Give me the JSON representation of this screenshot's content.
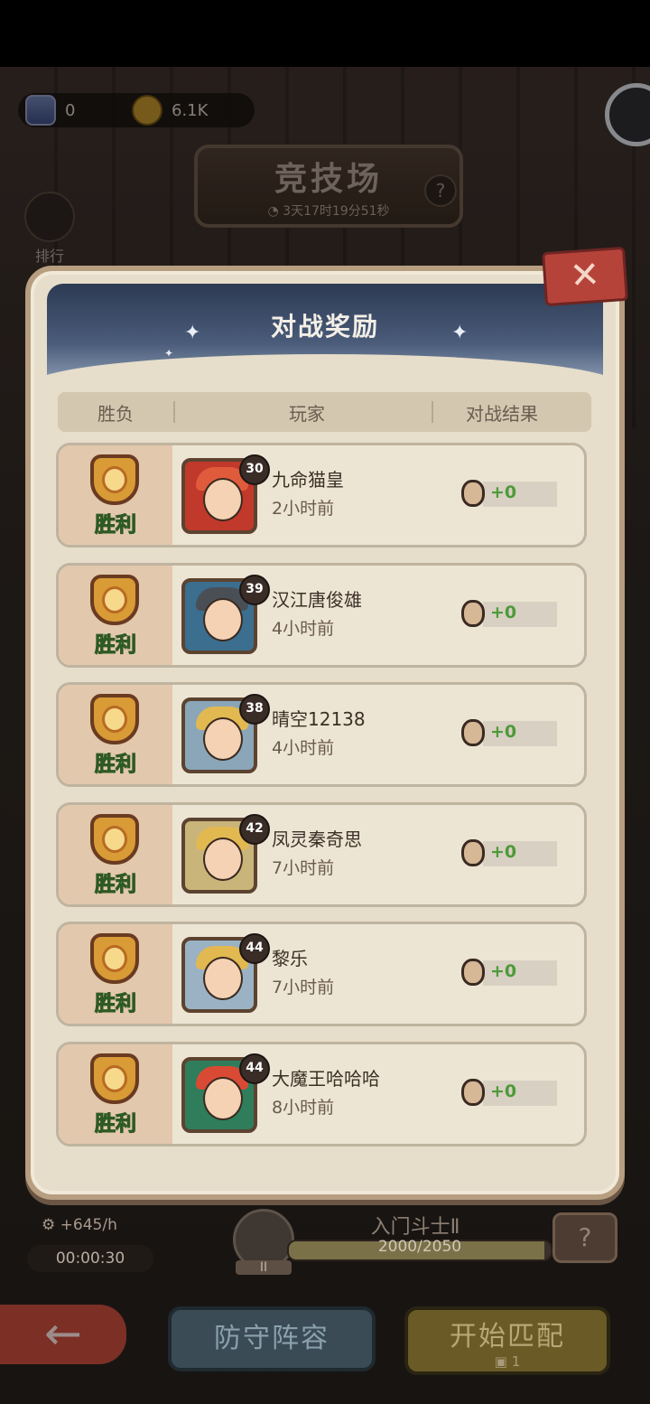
{
  "resources": {
    "cups": "0",
    "gears": "6.1K"
  },
  "arena": {
    "title": "竞技场",
    "time_left": "3天17时19分51秒",
    "help": "?",
    "rank_label": "排行"
  },
  "modal": {
    "title": "对战奖励",
    "close": "✕",
    "columns": [
      "胜负",
      "玩家",
      "对战结果"
    ]
  },
  "battles": [
    {
      "result": "胜利",
      "level": "30",
      "name": "九命猫皇",
      "time": "2小时前",
      "gain": "+0",
      "avatar_color": "#c0392b",
      "hair_color": "#e05a3c"
    },
    {
      "result": "胜利",
      "level": "39",
      "name": "汉江唐俊雄",
      "time": "4小时前",
      "gain": "+0",
      "avatar_color": "#3b6e8f",
      "hair_color": "#4a4f56"
    },
    {
      "result": "胜利",
      "level": "38",
      "name": "晴空12138",
      "time": "4小时前",
      "gain": "+0",
      "avatar_color": "#8aa6b8",
      "hair_color": "#e2b851"
    },
    {
      "result": "胜利",
      "level": "42",
      "name": "凤灵秦奇思",
      "time": "7小时前",
      "gain": "+0",
      "avatar_color": "#c9b47a",
      "hair_color": "#e2b851"
    },
    {
      "result": "胜利",
      "level": "44",
      "name": "黎乐",
      "time": "7小时前",
      "gain": "+0",
      "avatar_color": "#9ab2c4",
      "hair_color": "#e2b851"
    },
    {
      "result": "胜利",
      "level": "44",
      "name": "大魔王哈哈哈",
      "time": "8小时前",
      "gain": "+0",
      "avatar_color": "#2f7d5b",
      "hair_color": "#d94a35"
    }
  ],
  "footer": {
    "rate": "+645/h",
    "timer": "00:00:30",
    "rank_name": "入门斗士Ⅱ",
    "rank_badge": "II",
    "progress_text": "2000/2050",
    "progress_fraction": 0.9756,
    "chest": "?",
    "back": "←",
    "defense_label": "防守阵容",
    "match_label": "开始匹配",
    "match_cost": "1"
  }
}
